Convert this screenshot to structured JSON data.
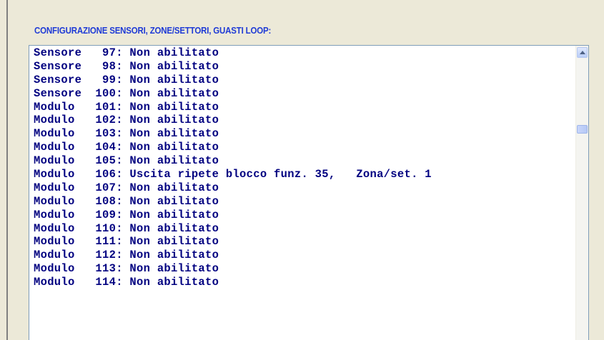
{
  "section": {
    "title": "CONFIGURAZIONE SENSORI, ZONE/SETTORI, GUASTI LOOP:"
  },
  "list": {
    "lines": [
      "Sensore   97: Non abilitato",
      "Sensore   98: Non abilitato",
      "Sensore   99: Non abilitato",
      "Sensore  100: Non abilitato",
      "Modulo   101: Non abilitato",
      "Modulo   102: Non abilitato",
      "Modulo   103: Non abilitato",
      "Modulo   104: Non abilitato",
      "Modulo   105: Non abilitato",
      "Modulo   106: Uscita ripete blocco funz. 35,   Zona/set. 1",
      "Modulo   107: Non abilitato",
      "Modulo   108: Non abilitato",
      "Modulo   109: Non abilitato",
      "Modulo   110: Non abilitato",
      "Modulo   111: Non abilitato",
      "Modulo   112: Non abilitato",
      "Modulo   113: Non abilitato",
      "Modulo   114: Non abilitato"
    ]
  },
  "colors": {
    "title": "#1f3bd6",
    "list_text": "#000080",
    "panel_bg": "#ece9d8",
    "listbox_border": "#7f9db9"
  },
  "icons": {
    "scroll_up": "chevron-up-icon"
  }
}
